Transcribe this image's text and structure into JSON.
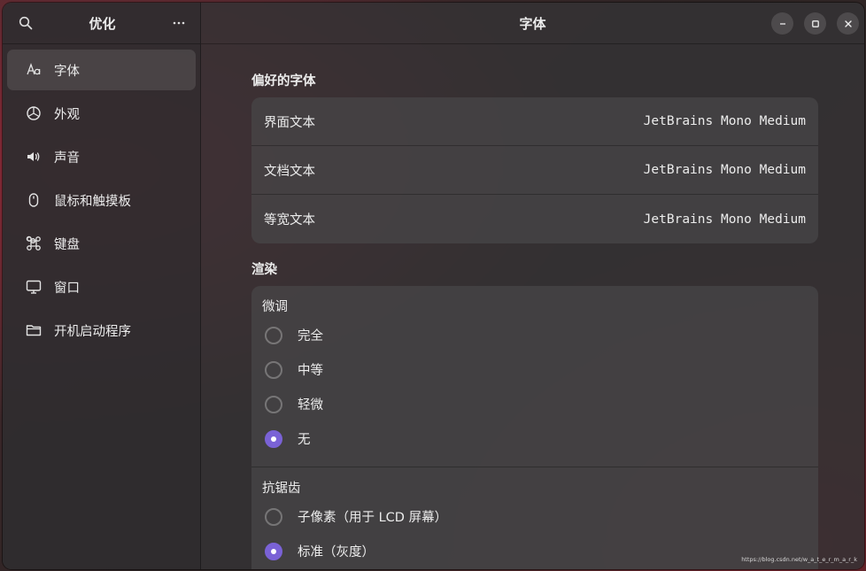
{
  "sidebar": {
    "title": "优化",
    "search_icon": "search-icon",
    "menu_icon": "more-horizontal-icon",
    "items": [
      {
        "label": "字体",
        "icon": "font-icon",
        "active": true
      },
      {
        "label": "外观",
        "icon": "appearance-icon"
      },
      {
        "label": "声音",
        "icon": "speaker-icon"
      },
      {
        "label": "鼠标和触摸板",
        "icon": "mouse-icon"
      },
      {
        "label": "键盘",
        "icon": "command-key-icon"
      },
      {
        "label": "窗口",
        "icon": "monitor-icon"
      },
      {
        "label": "开机启动程序",
        "icon": "folder-icon"
      }
    ]
  },
  "header": {
    "title": "字体"
  },
  "preferred_fonts": {
    "title": "偏好的字体",
    "rows": [
      {
        "label": "界面文本",
        "value": "JetBrains Mono Medium"
      },
      {
        "label": "文档文本",
        "value": "JetBrains Mono Medium"
      },
      {
        "label": "等宽文本",
        "value": "JetBrains Mono Medium"
      }
    ]
  },
  "rendering": {
    "title": "渲染",
    "hinting": {
      "label": "微调",
      "options": [
        {
          "label": "完全",
          "checked": false
        },
        {
          "label": "中等",
          "checked": false
        },
        {
          "label": "轻微",
          "checked": false
        },
        {
          "label": "无",
          "checked": true
        }
      ]
    },
    "antialiasing": {
      "label": "抗锯齿",
      "options": [
        {
          "label": "子像素（用于 LCD 屏幕）",
          "checked": false
        },
        {
          "label": "标准（灰度）",
          "checked": true
        }
      ]
    }
  },
  "colors": {
    "accent": "#7a62d6"
  },
  "watermark": "https://blog.csdn.net/w_a_t_e_r_m_a_r_k"
}
